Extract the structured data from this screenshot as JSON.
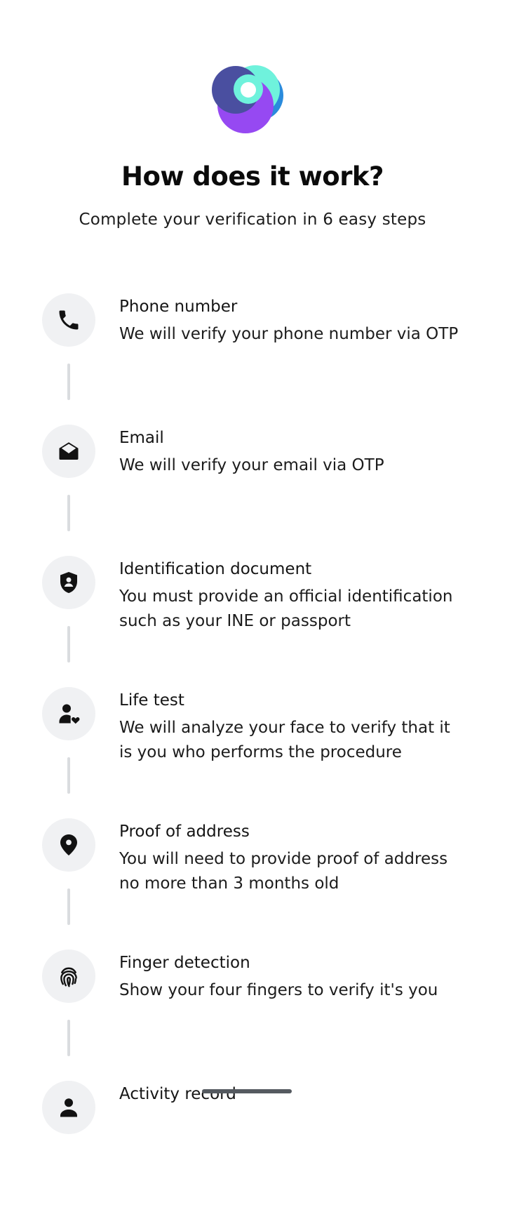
{
  "header": {
    "title": "How does it work?",
    "subtitle": "Complete your verification in 6 easy steps"
  },
  "colors": {
    "logo_indigo": "#4a4fa0",
    "logo_teal": "#6ff2dc",
    "logo_blue": "#2a8bdc",
    "logo_purple": "#9649f2",
    "icon_circle": "#f0f1f3",
    "connector": "#dadcdf",
    "text": "#151515"
  },
  "steps": [
    {
      "icon": "phone-icon",
      "title": "Phone number",
      "description": "We will verify your phone number via OTP"
    },
    {
      "icon": "envelope-icon",
      "title": "Email",
      "description": "We will verify your email via OTP"
    },
    {
      "icon": "shield-user-icon",
      "title": "Identification document",
      "description": "You must provide an official identification such as your INE or passport"
    },
    {
      "icon": "user-heart-icon",
      "title": "Life test",
      "description": "We will analyze your face to verify that it is you who performs the procedure"
    },
    {
      "icon": "location-pin-icon",
      "title": "Proof of address",
      "description": "You will need to provide proof of address no more than 3 months old"
    },
    {
      "icon": "fingerprint-icon",
      "title": "Finger detection",
      "description": "Show your four fingers to verify it's you"
    },
    {
      "icon": "user-icon",
      "title": "Activity record",
      "description": ""
    }
  ]
}
